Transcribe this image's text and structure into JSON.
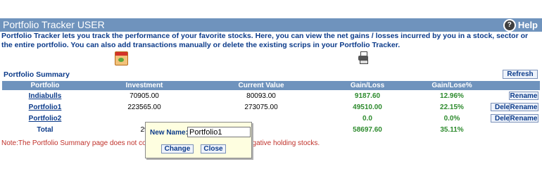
{
  "header": {
    "title": "Portfolio Tracker USER",
    "help_label": "Help",
    "help_icon": "?"
  },
  "intro": "Portfolio Tracker lets you track the performance of your favorite stocks. Here, you can view the net gains / losses incurred by you in a stock, sector or the entire portfolio. You can also add transactions manually or delete the existing scrips in your Portfolio Tracker.",
  "summary": {
    "label": "Portfolio Summary",
    "refresh_label": "Refresh",
    "columns": [
      "Portfolio",
      "Investment",
      "Current Value",
      "Gain/Loss",
      "Gain/Lose%"
    ],
    "rows": [
      {
        "name": "Indiabulls",
        "investment": "70905.00",
        "current": "80093.00",
        "gain": "9187.60",
        "gain_pct": "12.96%",
        "rename": "Rename"
      },
      {
        "name": "Portfolio1",
        "investment": "223565.00",
        "current": "273075.00",
        "gain": "49510.00",
        "gain_pct": "22.15%",
        "delete": "Delete",
        "rename": "Rename"
      },
      {
        "name": "Portfolio2",
        "investment": "",
        "current": "",
        "gain": "0.0",
        "gain_pct": "0.0%",
        "delete": "Delete",
        "rename": "Rename"
      }
    ],
    "total": {
      "label": "Total",
      "investment": "29",
      "gain": "58697.60",
      "gain_pct": "35.11%"
    }
  },
  "note": {
    "part1": "Note:The Portfolio Summary page does not conta",
    "part2": "egative holding stocks."
  },
  "popup": {
    "label": "New Name:",
    "value": "Portfolio1",
    "change_label": "Change",
    "close_label": "Close"
  },
  "colors": {
    "header_bg": "#6f93bd",
    "link": "#0c3b8a",
    "gain": "#2e8b2e",
    "note": "#c0322b",
    "popup_bg": "#fefee0"
  }
}
